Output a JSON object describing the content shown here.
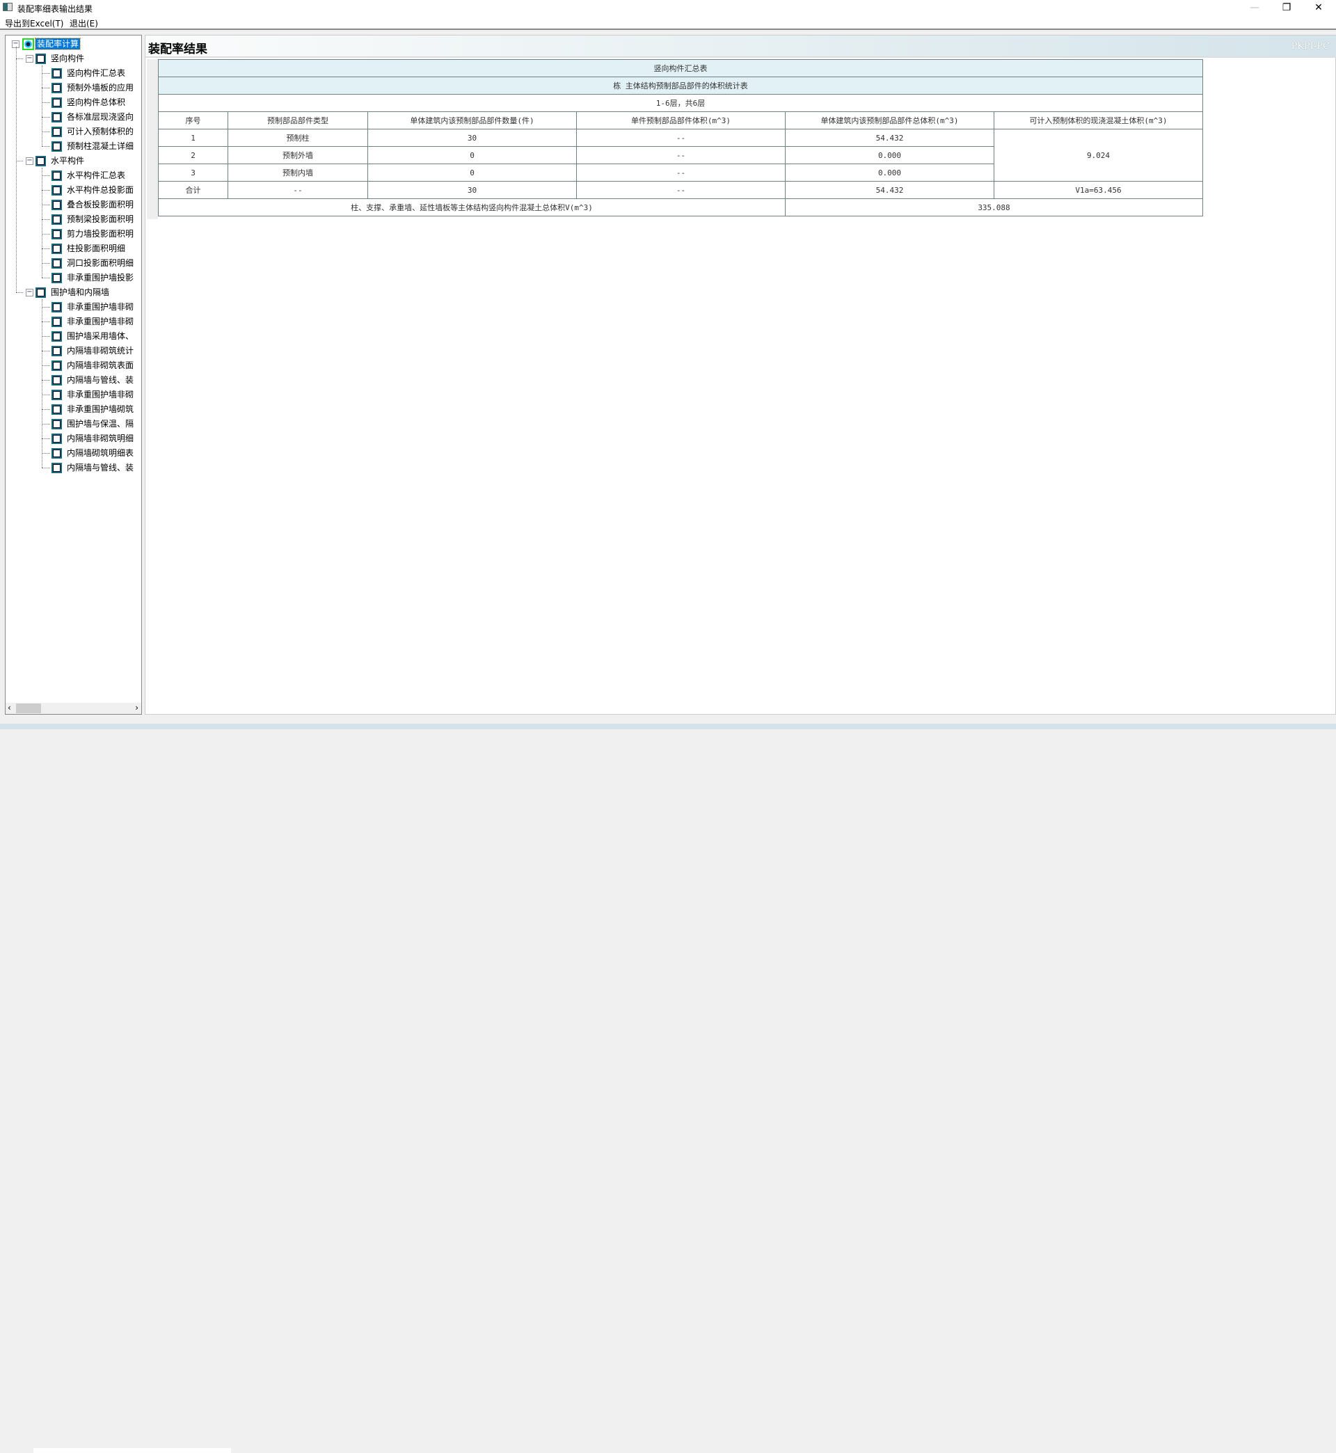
{
  "window": {
    "title": "装配率细表输出结果",
    "minimize": "—",
    "restore": "❐",
    "close": "✕"
  },
  "menu": [
    {
      "label": "导出到Excel(T)"
    },
    {
      "label": "退出(E)"
    }
  ],
  "tree": {
    "root": "装配率计算",
    "groups": [
      {
        "label": "竖向构件",
        "items": [
          "竖向构件汇总表",
          "预制外墙板的应用",
          "竖向构件总体积",
          "各标准层现浇竖向",
          "可计入预制体积的",
          "预制柱混凝土详细"
        ]
      },
      {
        "label": "水平构件",
        "items": [
          "水平构件汇总表",
          "水平构件总投影面",
          "叠合板投影面积明",
          "预制梁投影面积明",
          "剪力墙投影面积明",
          "柱投影面积明细",
          "洞口投影面积明细",
          "非承重围护墙投影"
        ]
      },
      {
        "label": "围护墙和内隔墙",
        "items": [
          "非承重围护墙非砌",
          "非承重围护墙非砌",
          "围护墙采用墙体、",
          "内隔墙非砌筑统计",
          "内隔墙非砌筑表面",
          "内隔墙与管线、装",
          "非承重围护墙非砌",
          "非承重围护墙砌筑",
          "围护墙与保温、隔",
          "内隔墙非砌筑明细",
          "内隔墙砌筑明细表",
          "内隔墙与管线、装"
        ]
      }
    ]
  },
  "main": {
    "title": "装配率结果",
    "pc_name": "PKPI-PC",
    "table": {
      "title": "竖向构件汇总表",
      "subtitle": "栋 主体结构预制部品部件的体积统计表",
      "floors": "1-6层，共6层",
      "headers": [
        "序号",
        "预制部品部件类型",
        "单体建筑内该预制部品部件数量(件)",
        "单件预制部品部件体积(m^3)",
        "单体建筑内该预制部品部件总体积(m^3)",
        "可计入预制体积的现浇混凝土体积(m^3)"
      ],
      "rows": [
        [
          "1",
          "预制柱",
          "30",
          "--",
          "54.432"
        ],
        [
          "2",
          "预制外墙",
          "0",
          "--",
          "0.000"
        ],
        [
          "3",
          "预制内墙",
          "0",
          "--",
          "0.000"
        ]
      ],
      "merged_cast_volume": "9.024",
      "total": [
        "合计",
        "--",
        "30",
        "--",
        "54.432",
        "V1a=63.456"
      ],
      "summary_label": "柱、支撑、承重墙、延性墙板等主体结构竖向构件混凝土总体积V(m^3)",
      "summary_value": "335.088"
    }
  },
  "scroll": {
    "left": "‹",
    "right": "›"
  }
}
